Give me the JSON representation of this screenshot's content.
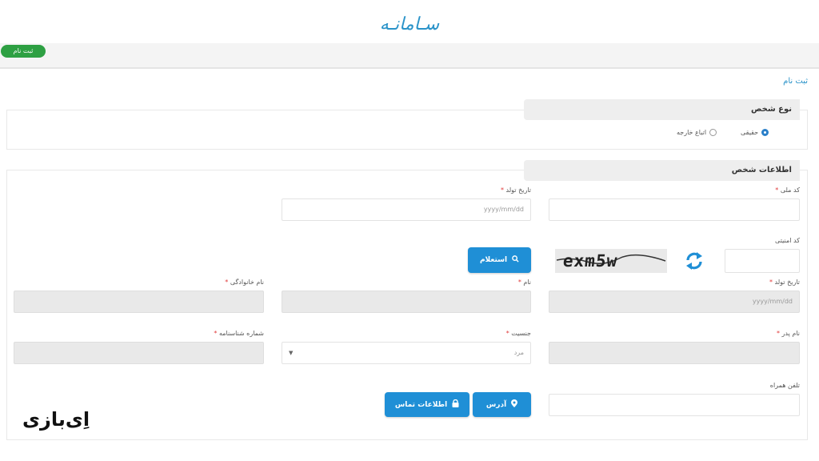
{
  "header": {
    "logo_text": "سـامانـه"
  },
  "topbar": {
    "register_button": "ثبت نام"
  },
  "breadcrumb": "ثبت نام",
  "person_type": {
    "title": "نوع شخص",
    "options": [
      {
        "label": "حقیقی",
        "selected": true
      },
      {
        "label": "اتباع خارجه",
        "selected": false
      }
    ]
  },
  "person_info": {
    "title": "اطلاعات شخص",
    "national_code": {
      "label": "کد ملی",
      "value": ""
    },
    "birth_date_top": {
      "label": "تاریخ تولد",
      "placeholder": "yyyy/mm/dd"
    },
    "security_code": {
      "label": "کد امنیتی",
      "value": "",
      "captcha": "exm5w"
    },
    "inquiry_button": "استعلام",
    "birth_date": {
      "label": "تاریخ تولد",
      "placeholder": "yyyy/mm/dd"
    },
    "first_name": {
      "label": "نام",
      "value": ""
    },
    "last_name": {
      "label": "نام خانوادگی",
      "value": ""
    },
    "father_name": {
      "label": "نام پدر",
      "value": ""
    },
    "gender": {
      "label": "جنسیت",
      "value": "مرد"
    },
    "id_number": {
      "label": "شماره شناسنامه",
      "value": ""
    },
    "mobile": {
      "label": "تلفن همراه",
      "value": ""
    },
    "address_button": "آدرس",
    "contact_button": "اطلاعات تماس"
  },
  "watermark": "اِی‌بازی",
  "colors": {
    "accent": "#1f8fd6",
    "register": "#2ea043",
    "required": "#e03a3a"
  }
}
